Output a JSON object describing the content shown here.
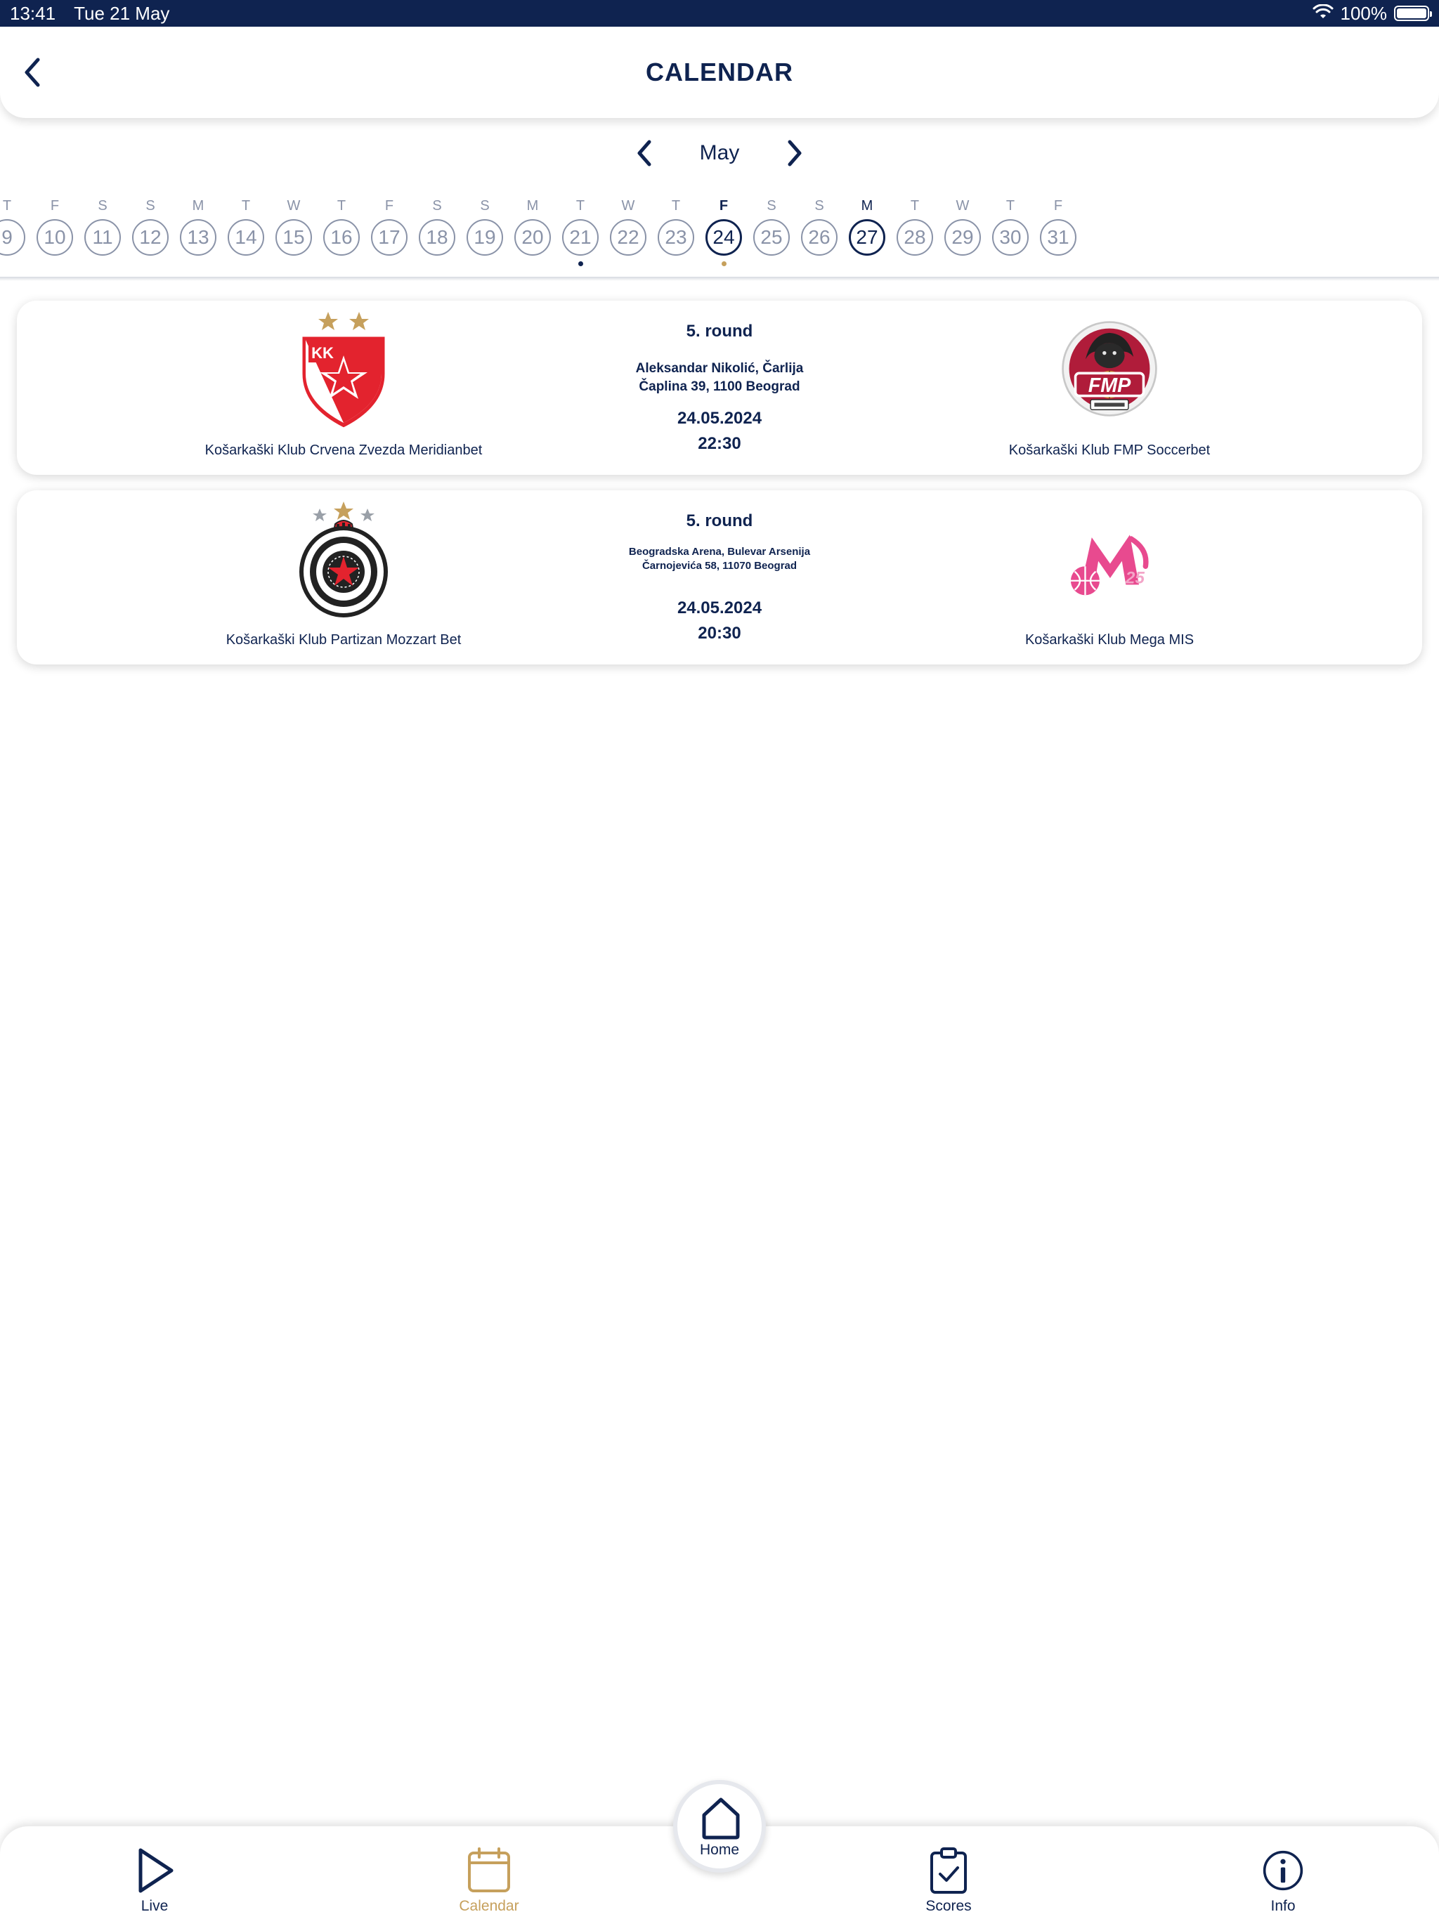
{
  "status_bar": {
    "time": "13:41",
    "date": "Tue 21 May",
    "battery": "100%"
  },
  "header": {
    "title": "CALENDAR"
  },
  "month_nav": {
    "month": "May"
  },
  "days": [
    {
      "letter": "T",
      "num": "9"
    },
    {
      "letter": "F",
      "num": "10"
    },
    {
      "letter": "S",
      "num": "11"
    },
    {
      "letter": "S",
      "num": "12"
    },
    {
      "letter": "M",
      "num": "13"
    },
    {
      "letter": "T",
      "num": "14"
    },
    {
      "letter": "W",
      "num": "15"
    },
    {
      "letter": "T",
      "num": "16"
    },
    {
      "letter": "F",
      "num": "17"
    },
    {
      "letter": "S",
      "num": "18"
    },
    {
      "letter": "S",
      "num": "19"
    },
    {
      "letter": "M",
      "num": "20"
    },
    {
      "letter": "T",
      "num": "21"
    },
    {
      "letter": "W",
      "num": "22"
    },
    {
      "letter": "T",
      "num": "23"
    },
    {
      "letter": "F",
      "num": "24"
    },
    {
      "letter": "S",
      "num": "25"
    },
    {
      "letter": "S",
      "num": "26"
    },
    {
      "letter": "M",
      "num": "27"
    },
    {
      "letter": "T",
      "num": "28"
    },
    {
      "letter": "W",
      "num": "29"
    },
    {
      "letter": "T",
      "num": "30"
    },
    {
      "letter": "F",
      "num": "31"
    }
  ],
  "selected_day": "24",
  "today_day": "27",
  "event_day": "21",
  "colors": {
    "navy": "#0f2350",
    "gold": "#c6a05c",
    "muted": "#8a93a8",
    "zvezda_red": "#e3232e",
    "fmp_red": "#b01c3a",
    "mega_pink": "#e84a8f"
  },
  "matches": [
    {
      "home_team": "Košarkaški Klub Crvena Zvezda Meridianbet",
      "away_team": "Košarkaški Klub FMP Soccerbet",
      "round": "5. round",
      "venue": "Aleksandar Nikolić, Čarlija Čaplina 39, 1100 Beograd",
      "date": "24.05.2024",
      "time": "22:30",
      "home_logo": "crvena-zvezda-logo",
      "away_logo": "fmp-logo"
    },
    {
      "home_team": "Košarkaški Klub Partizan Mozzart Bet",
      "away_team": "Košarkaški Klub Mega MIS",
      "round": "5. round",
      "venue": "Beogradska Arena, Bulevar Arsenija Čarnojevića 58, 11070 Beograd",
      "date": "24.05.2024",
      "time": "20:30",
      "home_logo": "partizan-logo",
      "away_logo": "mega-logo"
    }
  ],
  "tab_bar": {
    "live": "Live",
    "calendar": "Calendar",
    "home": "Home",
    "scores": "Scores",
    "info": "Info"
  }
}
